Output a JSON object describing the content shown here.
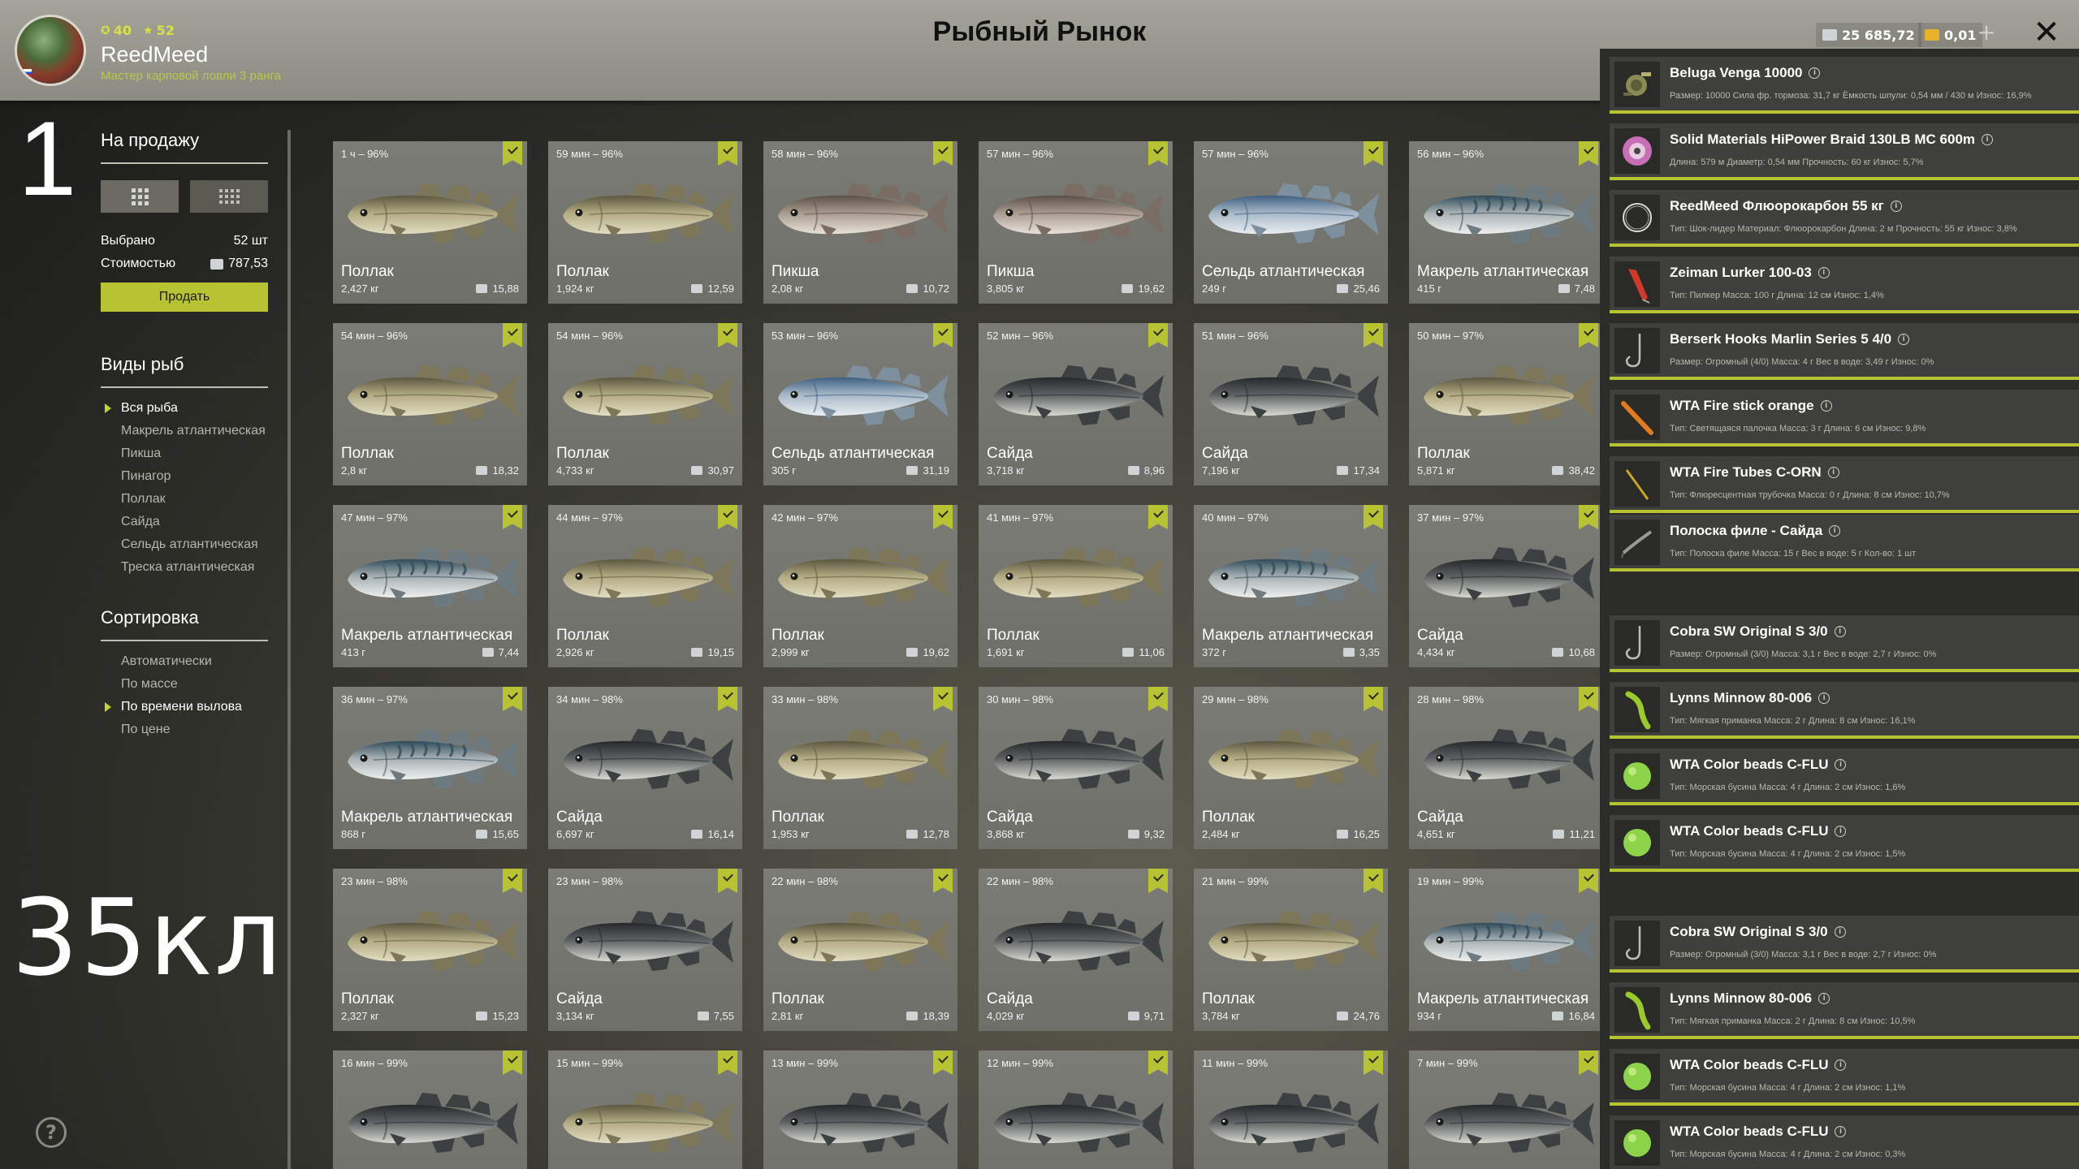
{
  "header": {
    "title": "Рыбный Рынок",
    "player": {
      "name": "ReedMeed",
      "rank": "Мастер карповой ловли 3 ранга",
      "stat_a": "40",
      "stat_b": "52"
    },
    "currency": {
      "silver": "25 685,72",
      "gold": "0,01"
    }
  },
  "overlay": {
    "number": "1",
    "text": "35кл"
  },
  "left": {
    "sale_heading": "На продажу",
    "selected_label": "Выбрано",
    "selected_value": "52 шт",
    "cost_label": "Стоимостью",
    "cost_value": "787,53",
    "sell_button": "Продать",
    "species_heading": "Виды рыб",
    "species": [
      "Вся рыба",
      "Макрель атлантическая",
      "Пикша",
      "Пинагор",
      "Поллак",
      "Сайда",
      "Сельдь атлантическая",
      "Треска атлантическая"
    ],
    "species_active": 0,
    "sort_heading": "Сортировка",
    "sort": [
      "Автоматически",
      "По массе",
      "По времени вылова",
      "По цене"
    ],
    "sort_active": 2
  },
  "fish": [
    {
      "time": "1 ч – 96%",
      "name": "Поллак",
      "mass": "2,427 кг",
      "price": "15,88",
      "kind": "pollock"
    },
    {
      "time": "59 мин – 96%",
      "name": "Поллак",
      "mass": "1,924 кг",
      "price": "12,59",
      "kind": "pollock"
    },
    {
      "time": "58 мин – 96%",
      "name": "Пикша",
      "mass": "2,08 кг",
      "price": "10,72",
      "kind": "haddock"
    },
    {
      "time": "57 мин – 96%",
      "name": "Пикша",
      "mass": "3,805 кг",
      "price": "19,62",
      "kind": "haddock"
    },
    {
      "time": "57 мин – 96%",
      "name": "Сельдь атлантическая",
      "mass": "249 г",
      "price": "25,46",
      "kind": "herring"
    },
    {
      "time": "56 мин – 96%",
      "name": "Макрель атлантическая",
      "mass": "415 г",
      "price": "7,48",
      "kind": "mackerel"
    },
    {
      "time": "54 мин – 96%",
      "name": "Поллак",
      "mass": "2,8 кг",
      "price": "18,32",
      "kind": "pollock"
    },
    {
      "time": "54 мин – 96%",
      "name": "Поллак",
      "mass": "4,733 кг",
      "price": "30,97",
      "kind": "pollock"
    },
    {
      "time": "53 мин – 96%",
      "name": "Сельдь атлантическая",
      "mass": "305 г",
      "price": "31,19",
      "kind": "herring"
    },
    {
      "time": "52 мин – 96%",
      "name": "Сайда",
      "mass": "3,718 кг",
      "price": "8,96",
      "kind": "saithe"
    },
    {
      "time": "51 мин – 96%",
      "name": "Сайда",
      "mass": "7,196 кг",
      "price": "17,34",
      "kind": "saithe"
    },
    {
      "time": "50 мин – 97%",
      "name": "Поллак",
      "mass": "5,871 кг",
      "price": "38,42",
      "kind": "pollock"
    },
    {
      "time": "47 мин – 97%",
      "name": "Макрель атлантическая",
      "mass": "413 г",
      "price": "7,44",
      "kind": "mackerel"
    },
    {
      "time": "44 мин – 97%",
      "name": "Поллак",
      "mass": "2,926 кг",
      "price": "19,15",
      "kind": "pollock"
    },
    {
      "time": "42 мин – 97%",
      "name": "Поллак",
      "mass": "2,999 кг",
      "price": "19,62",
      "kind": "pollock"
    },
    {
      "time": "41 мин – 97%",
      "name": "Поллак",
      "mass": "1,691 кг",
      "price": "11,06",
      "kind": "pollock"
    },
    {
      "time": "40 мин – 97%",
      "name": "Макрель атлантическая",
      "mass": "372 г",
      "price": "3,35",
      "kind": "mackerel"
    },
    {
      "time": "37 мин – 97%",
      "name": "Сайда",
      "mass": "4,434 кг",
      "price": "10,68",
      "kind": "saithe"
    },
    {
      "time": "36 мин – 97%",
      "name": "Макрель атлантическая",
      "mass": "868 г",
      "price": "15,65",
      "kind": "mackerel"
    },
    {
      "time": "34 мин – 98%",
      "name": "Сайда",
      "mass": "6,697 кг",
      "price": "16,14",
      "kind": "saithe"
    },
    {
      "time": "33 мин – 98%",
      "name": "Поллак",
      "mass": "1,953 кг",
      "price": "12,78",
      "kind": "pollock"
    },
    {
      "time": "30 мин – 98%",
      "name": "Сайда",
      "mass": "3,868 кг",
      "price": "9,32",
      "kind": "saithe"
    },
    {
      "time": "29 мин – 98%",
      "name": "Поллак",
      "mass": "2,484 кг",
      "price": "16,25",
      "kind": "pollock"
    },
    {
      "time": "28 мин – 98%",
      "name": "Сайда",
      "mass": "4,651 кг",
      "price": "11,21",
      "kind": "saithe"
    },
    {
      "time": "23 мин – 98%",
      "name": "Поллак",
      "mass": "2,327 кг",
      "price": "15,23",
      "kind": "pollock"
    },
    {
      "time": "23 мин – 98%",
      "name": "Сайда",
      "mass": "3,134 кг",
      "price": "7,55",
      "kind": "saithe"
    },
    {
      "time": "22 мин – 98%",
      "name": "Поллак",
      "mass": "2,81 кг",
      "price": "18,39",
      "kind": "pollock"
    },
    {
      "time": "22 мин – 98%",
      "name": "Сайда",
      "mass": "4,029 кг",
      "price": "9,71",
      "kind": "saithe"
    },
    {
      "time": "21 мин – 99%",
      "name": "Поллак",
      "mass": "3,784 кг",
      "price": "24,76",
      "kind": "pollock"
    },
    {
      "time": "19 мин – 99%",
      "name": "Макрель атлантическая",
      "mass": "934 г",
      "price": "16,84",
      "kind": "mackerel"
    },
    {
      "time": "16 мин – 99%",
      "name": "",
      "mass": "",
      "price": "",
      "kind": "saithe"
    },
    {
      "time": "15 мин – 99%",
      "name": "",
      "mass": "",
      "price": "",
      "kind": "pollock"
    },
    {
      "time": "13 мин – 99%",
      "name": "",
      "mass": "",
      "price": "",
      "kind": "saithe"
    },
    {
      "time": "12 мин – 99%",
      "name": "",
      "mass": "",
      "price": "",
      "kind": "saithe"
    },
    {
      "time": "11 мин – 99%",
      "name": "",
      "mass": "",
      "price": "",
      "kind": "saithe"
    },
    {
      "time": "7 мин – 99%",
      "name": "",
      "mass": "",
      "price": "",
      "kind": "saithe"
    }
  ],
  "tackle": [
    {
      "name": "Beluga Venga 10000",
      "details": "Размер: 10000  Сила фр. тормоза: 31,7 кг  Ёмкость шпули: 0,54 мм / 430 м  Износ: 16,9%",
      "icon": "reel-icon",
      "thumb": "reel"
    },
    {
      "name": "Solid Materials HiPower Braid 130LB MC 600m",
      "details": "Длина: 579 м  Диаметр: 0,54 мм  Прочность: 60 кг  Износ: 5,7%",
      "icon": "line-spool-icon",
      "thumb": "spool"
    },
    {
      "name": "ReedMeed Флюорокарбон 55 кг",
      "details": "Тип: Шок-лидер  Материал: Флюорокарбон  Длина: 2 м  Прочность: 55 кг  Износ: 3,8%",
      "icon": "leader-coil-icon",
      "thumb": "coil"
    },
    {
      "name": "Zeiman Lurker 100-03",
      "details": "Тип: Пилкер  Масса: 100 г  Длина: 12 см  Износ: 1,4%",
      "icon": "pilker-lure-icon",
      "thumb": "pilker"
    },
    {
      "name": "Berserk Hooks Marlin Series 5 4/0",
      "details": "Размер: Огромный (4/0)  Масса: 4 г  Вес в воде: 3,49 г  Износ: 0%",
      "icon": "hook-icon",
      "thumb": "hook"
    },
    {
      "name": "WTA Fire stick orange",
      "details": "Тип: Светящаяся палочка  Масса: 3 г  Длина: 6 см  Износ: 9,8%",
      "icon": "glow-stick-icon",
      "thumb": "stick"
    },
    {
      "name": "WTA Fire Tubes C-ORN",
      "details": "Тип: Флюресцентная трубочка  Масса: 0 г  Длина: 8 см  Износ: 10,7%",
      "icon": "tube-icon",
      "thumb": "tube"
    },
    {
      "name": "Полоска филе - Сайда",
      "details": "Тип: Полоска филе  Масса: 15 г  Вес в воде: 5 г  Кол-во: 1 шт",
      "icon": "fillet-strip-icon",
      "thumb": "fillet"
    },
    {
      "name": "Cobra SW Original S 3/0",
      "details": "Размер: Огромный (3/0)  Масса: 3,1 г  Вес в воде: 2,7 г  Износ: 0%",
      "icon": "hook-icon",
      "thumb": "hook"
    },
    {
      "name": "Lynns Minnow 80-006",
      "details": "Тип: Мягкая приманка  Масса: 2 г  Длина: 8 см  Износ: 16,1%",
      "icon": "soft-bait-icon",
      "thumb": "minnow"
    },
    {
      "name": "WTA Color beads C-FLU",
      "details": "Тип: Морская бусина  Масса: 4 г  Длина: 2 см  Износ: 1,6%",
      "icon": "bead-icon",
      "thumb": "bead"
    },
    {
      "name": "WTA Color beads C-FLU",
      "details": "Тип: Морская бусина  Масса: 4 г  Длина: 2 см  Износ: 1,5%",
      "icon": "bead-icon",
      "thumb": "bead"
    },
    {
      "name": "Cobra SW Original S 3/0",
      "details": "Размер: Огромный (3/0)  Масса: 3,1 г  Вес в воде: 2,7 г  Износ: 0%",
      "icon": "hook-icon",
      "thumb": "hook"
    },
    {
      "name": "Lynns Minnow 80-006",
      "details": "Тип: Мягкая приманка  Масса: 2 г  Длина: 8 см  Износ: 10,5%",
      "icon": "soft-bait-icon",
      "thumb": "minnow"
    },
    {
      "name": "WTA Color beads C-FLU",
      "details": "Тип: Морская бусина  Масса: 4 г  Длина: 2 см  Износ: 1,1%",
      "icon": "bead-icon",
      "thumb": "bead"
    },
    {
      "name": "WTA Color beads C-FLU",
      "details": "Тип: Морская бусина  Масса: 4 г  Длина: 2 см  Износ: 0,3%",
      "icon": "bead-icon",
      "thumb": "bead"
    }
  ],
  "colors": {
    "accent": "#b8c334",
    "topbar": "#9a9a91",
    "card": "#767670"
  }
}
